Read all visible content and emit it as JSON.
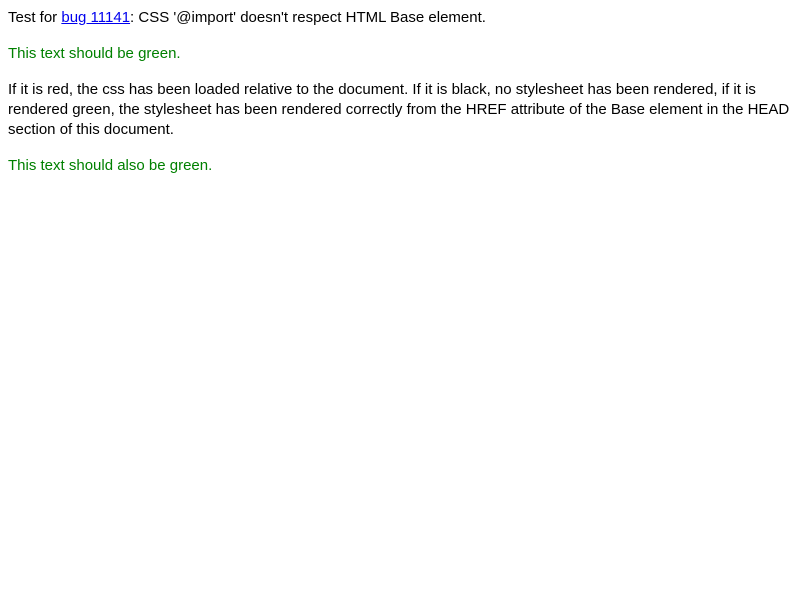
{
  "intro": {
    "prefix": "Test for ",
    "link_text": "bug 11141",
    "suffix": ": CSS '@import' doesn't respect HTML Base element."
  },
  "green_text_1": "This text should be green.",
  "explanation": "If it is red, the css has been loaded relative to the document. If it is black, no stylesheet has been rendered, if it is rendered green, the stylesheet has been rendered correctly from the HREF attribute of the Base element in the HEAD section of this document.",
  "green_text_2": "This text should also be green.",
  "colors": {
    "link": "#0000ee",
    "green": "#008000",
    "text": "#000000"
  }
}
